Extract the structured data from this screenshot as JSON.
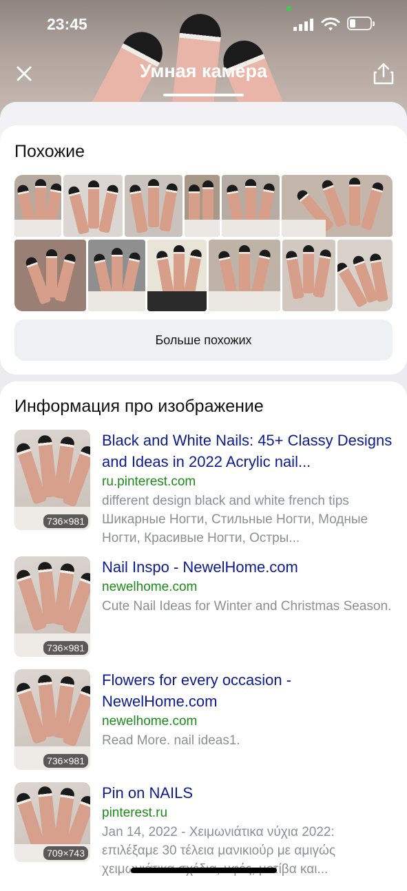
{
  "status_bar": {
    "time": "23:45"
  },
  "header": {
    "title": "Умная камера",
    "close_icon": "close-icon",
    "share_icon": "share-icon"
  },
  "similar": {
    "title": "Похожие",
    "more_button": "Больше похожих",
    "thumbnail_count": 13
  },
  "info": {
    "title": "Информация про изображение",
    "results": [
      {
        "title": "Black and White Nails: 45+ Classy Designs and Ideas in 2022 Acrylic nail...",
        "host": "ru.pinterest.com",
        "description": "different design black and white french tips Шикарные Ногти, Стильные Ногти, Модные Ногти, Красивые Ногти, Остры...",
        "size": "736×981"
      },
      {
        "title": "Nail Inspo - NewelHome.com",
        "host": "newelhome.com",
        "description": "Cute Nail Ideas for Winter and Christmas Season.",
        "size": "736×981"
      },
      {
        "title": "Flowers for every occasion - NewelHome.com",
        "host": "newelhome.com",
        "description": "Read More. nail ideas1.",
        "size": "736×981"
      },
      {
        "title": "Pin on NAILS",
        "host": "pinterest.ru",
        "description": "Jan 14, 2022 - Χειμωνιάτικα νύχια 2022: επιλέξαμε 30 τέλεια μανικιούρ με αμιγώς χειμωνιάτικα σχέδια, υφές, μοτίβα και...",
        "size": "709×743"
      }
    ]
  },
  "colors": {
    "link": "#0b1a91",
    "host": "#1b8a17",
    "muted": "#8b8e94",
    "button_bg": "#eff0f3"
  }
}
